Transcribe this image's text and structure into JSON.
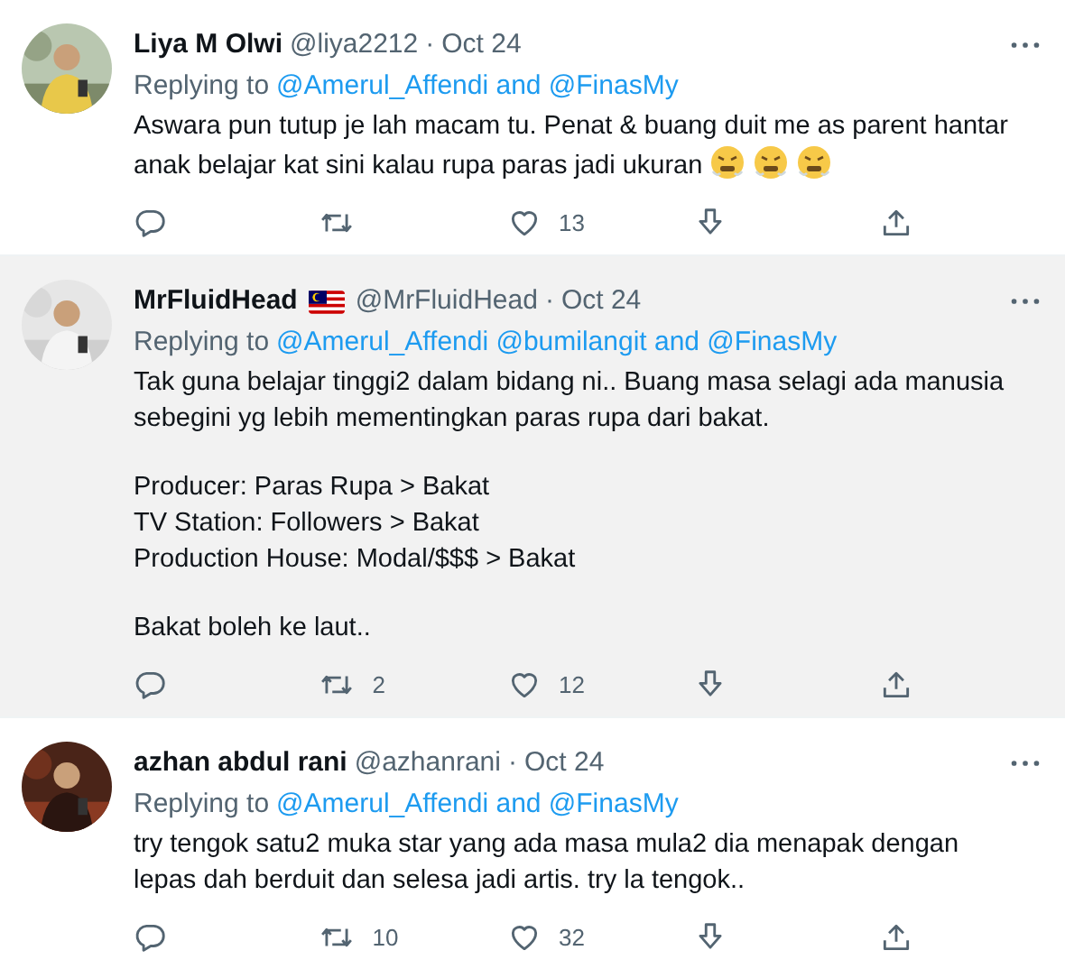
{
  "tweets": [
    {
      "name": "Liya M Olwi",
      "flag": false,
      "handle": "@liya2212",
      "separator": "·",
      "date": "Oct 24",
      "highlighted": false,
      "reply_prefix": "Replying to",
      "reply_mentions": "@Amerul_Affendi and @FinasMy",
      "paragraphs": [
        "Aswara pun tutup je lah macam tu. Penat & buang duit me as parent hantar anak belajar kat sini kalau rupa paras jadi ukuran"
      ],
      "emojis": [
        {
          "kind": "angry"
        },
        {
          "kind": "angry"
        },
        {
          "kind": "angry"
        }
      ],
      "actions": [
        {
          "kind": "reply"
        },
        {
          "kind": "retweet"
        },
        {
          "kind": "like",
          "count": "13"
        },
        {
          "kind": "download"
        },
        {
          "kind": "share"
        }
      ]
    },
    {
      "name": "MrFluidHead",
      "flag": true,
      "handle": "@MrFluidHead",
      "separator": "·",
      "date": "Oct 24",
      "highlighted": true,
      "reply_prefix": "Replying to",
      "reply_mentions": "@Amerul_Affendi @bumilangit and @FinasMy",
      "paragraphs": [
        "Tak guna belajar tinggi2 dalam bidang ni.. Buang masa selagi ada manusia sebegini yg lebih mementingkan paras rupa dari bakat.",
        "Producer: Paras Rupa > Bakat\nTV Station: Followers > Bakat\nProduction House: Modal/$$$ > Bakat",
        "Bakat boleh ke laut.."
      ],
      "actions": [
        {
          "kind": "reply"
        },
        {
          "kind": "retweet",
          "count": "2"
        },
        {
          "kind": "like",
          "count": "12"
        },
        {
          "kind": "download"
        },
        {
          "kind": "share"
        }
      ]
    },
    {
      "name": "azhan abdul rani",
      "flag": false,
      "handle": "@azhanrani",
      "separator": "·",
      "date": "Oct 24",
      "highlighted": false,
      "reply_prefix": "Replying to",
      "reply_mentions": "@Amerul_Affendi and @FinasMy",
      "paragraphs": [
        "try tengok satu2 muka star yang ada masa mula2 dia menapak dengan lepas dah berduit dan selesa jadi artis. try la tengok.."
      ],
      "actions": [
        {
          "kind": "reply"
        },
        {
          "kind": "retweet",
          "count": "10"
        },
        {
          "kind": "like",
          "count": "32"
        },
        {
          "kind": "download"
        },
        {
          "kind": "share"
        }
      ]
    }
  ]
}
